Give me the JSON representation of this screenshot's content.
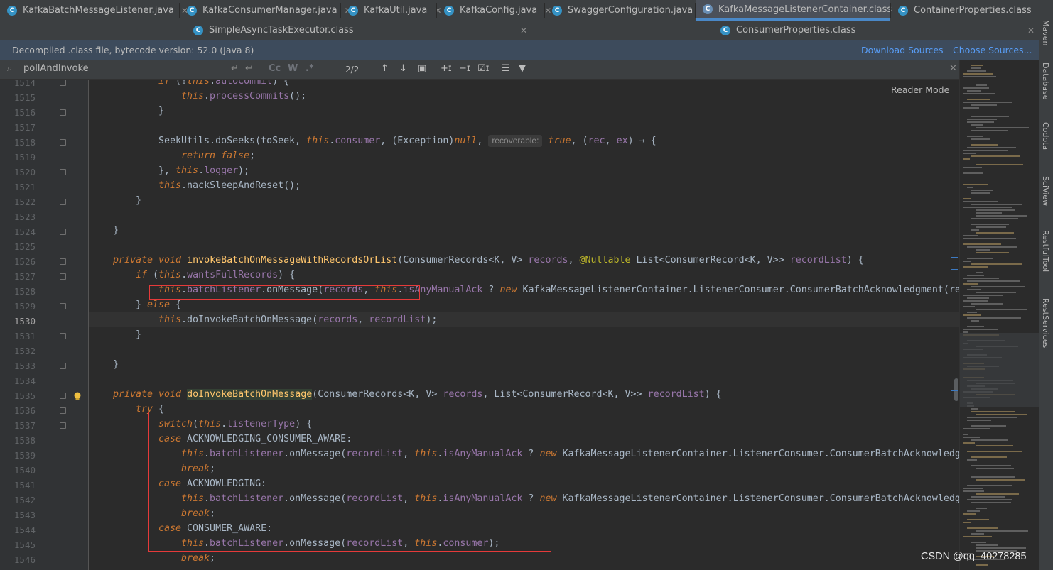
{
  "tabs_row1": [
    {
      "label": "KafkaBatchMessageListener.java",
      "active": false
    },
    {
      "label": "KafkaConsumerManager.java",
      "active": false
    },
    {
      "label": "KafkaUtil.java",
      "active": false
    },
    {
      "label": "KafkaConfig.java",
      "active": false
    },
    {
      "label": "SwaggerConfiguration.java",
      "active": false
    },
    {
      "label": "KafkaMessageListenerContainer.class",
      "active": true
    },
    {
      "label": "ContainerProperties.class",
      "active": false
    }
  ],
  "tabs_row2": [
    {
      "label": "SimpleAsyncTaskExecutor.class"
    },
    {
      "label": "ConsumerProperties.class"
    }
  ],
  "infobar": {
    "text": "Decompiled .class file, bytecode version: 52.0 (Java 8)",
    "download": "Download Sources",
    "choose": "Choose Sources..."
  },
  "search": {
    "query": "pollAndInvoke",
    "count": "2/2",
    "cc": "Cc",
    "w": "W",
    "regex": ".*"
  },
  "reader_mode": "Reader Mode",
  "hint_label": "recoverable:",
  "line_numbers": [
    "1514",
    "1515",
    "1516",
    "1517",
    "1518",
    "1519",
    "1520",
    "1521",
    "1522",
    "1523",
    "1524",
    "1525",
    "1526",
    "1527",
    "1528",
    "1529",
    "1530",
    "1531",
    "1532",
    "1533",
    "1534",
    "1535",
    "1536",
    "1537",
    "1538",
    "1539",
    "1540",
    "1541",
    "1542",
    "1543",
    "1544",
    "1545",
    "1546"
  ],
  "current_line": "1530",
  "side_tools": [
    "Maven",
    "Database",
    "Codota",
    "SciView",
    "RestfulTool",
    "RestServices"
  ],
  "watermark": "CSDN @qq_40278285",
  "colors": {
    "keyword": "#cc7832",
    "field": "#9876aa",
    "method": "#ffc66d",
    "text": "#a9b7c6",
    "highlight_box": "#e63a3a"
  }
}
